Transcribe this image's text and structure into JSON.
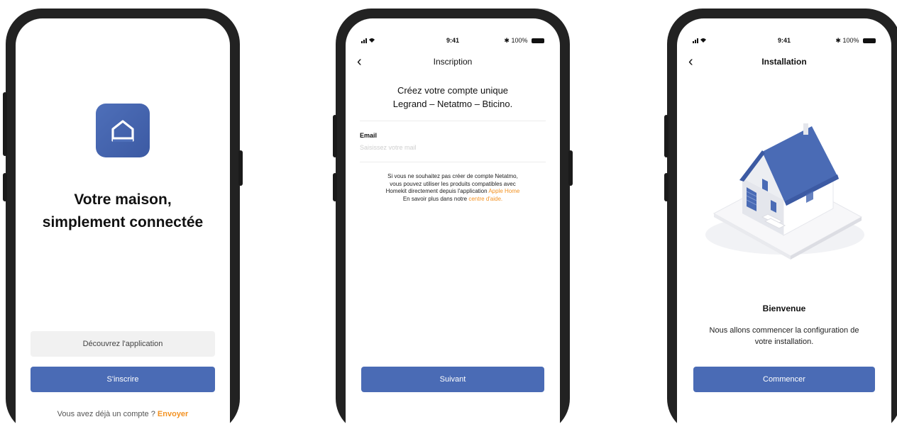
{
  "colors": {
    "primary": "#4a6bb5",
    "accent": "#f39222",
    "frame": "#222222"
  },
  "screen1": {
    "headline_line1": "Votre maison,",
    "headline_line2": "simplement connectée",
    "discover_button": "Découvrez l'application",
    "signup_button": "S'inscrire",
    "login_prompt": "Vous avez déjà un compte ?",
    "login_link": "Envoyer",
    "app_icon": "home-icon"
  },
  "screen2": {
    "status": {
      "time": "9:41",
      "battery": "100%"
    },
    "nav_title": "Inscription",
    "back_icon": "chevron-left-icon",
    "heading_line1": "Créez votre compte unique",
    "heading_line2": "Legrand – Netatmo – Bticino.",
    "email_label": "Email",
    "email_placeholder": "Saisissez votre mail",
    "info_line1": "Si vous ne souhaitez pas créer de compte Netatmo,",
    "info_line2": "vous pouvez utiliser les produits compatibles avec",
    "info_line3_prefix": "Homekit directement depuis l'application",
    "info_apple_home": "Apple Home",
    "info_line4_prefix": "En savoir plus dans notre",
    "info_help_link": "centre d'aide.",
    "next_button": "Suivant"
  },
  "screen3": {
    "status": {
      "time": "9:41",
      "battery": "100%"
    },
    "nav_title": "Installation",
    "back_icon": "chevron-left-icon",
    "illustration": "house-illustration",
    "welcome_title": "Bienvenue",
    "desc_line1": "Nous allons commencer la configuration de",
    "desc_line2": "votre installation.",
    "start_button": "Commencer"
  }
}
